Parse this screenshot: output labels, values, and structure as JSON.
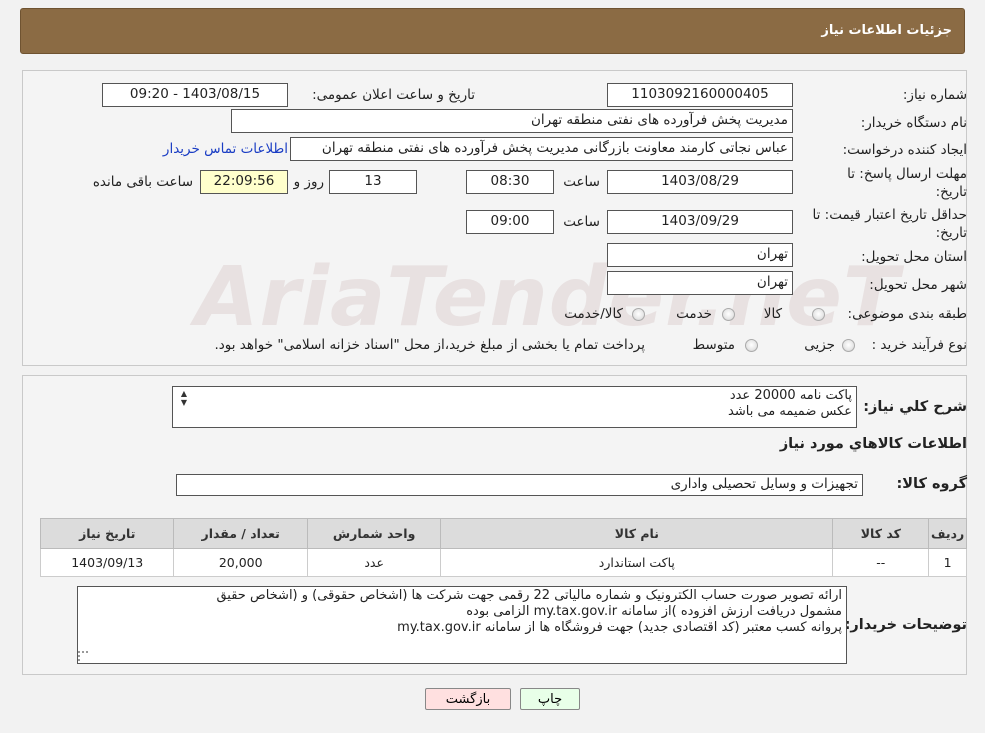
{
  "header": {
    "title": "جزئیات اطلاعات نیاز"
  },
  "form": {
    "need_number_label": "شماره نیاز:",
    "need_number": "1103092160000405",
    "announce_label": "تاریخ و ساعت اعلان عمومی:",
    "announce_value": "1403/08/15 - 09:20",
    "buyer_org_label": "نام دستگاه خریدار:",
    "buyer_org": "مدیریت پخش فرآورده های نفتی منطقه تهران",
    "creator_label": "ایجاد کننده درخواست:",
    "creator": "عباس نجاتی کارمند معاونت بازرگانی مدیریت پخش فرآورده های نفتی منطقه تهران",
    "contact_link": "اطلاعات تماس خریدار",
    "deadline_label_1": "مهلت ارسال پاسخ: تا",
    "deadline_label_2": "تاریخ:",
    "deadline_date": "1403/08/29",
    "time_label": "ساعت",
    "deadline_time": "08:30",
    "days": "13",
    "days_label": "روز و",
    "remaining": "22:09:56",
    "remaining_label": "ساعت باقی مانده",
    "validity_label_1": "حداقل تاریخ اعتبار قیمت: تا",
    "validity_label_2": "تاریخ:",
    "validity_date": "1403/09/29",
    "validity_time": "09:00",
    "province_label": "استان محل تحویل:",
    "province": "تهران",
    "city_label": "شهر محل تحویل:",
    "city": "تهران",
    "category_label": "طبقه بندی موضوعی:",
    "category_options": [
      "کالا",
      "خدمت",
      "کالا/خدمت"
    ],
    "process_label": "نوع فرآیند خرید :",
    "process_options": [
      "جزیی",
      "متوسط"
    ],
    "process_note": "پرداخت تمام یا بخشی از مبلغ خرید،از محل \"اسناد خزانه اسلامی\" خواهد بود."
  },
  "description": {
    "label": "شرح کلي نیاز:",
    "lines": [
      "پاکت نامه 20000 عدد",
      "عکس ضمیمه می باشد"
    ]
  },
  "goods": {
    "section_title": "اطلاعات کالاهاي مورد نیاز",
    "group_label": "گروه کالا:",
    "group_value": "تجهیزات و وسایل تحصیلی واداری"
  },
  "table": {
    "headers": [
      "ردیف",
      "کد کالا",
      "نام کالا",
      "واحد شمارش",
      "تعداد / مقدار",
      "تاریخ نیاز"
    ],
    "rows": [
      {
        "row": "1",
        "code": "--",
        "name": "پاکت استاندارد",
        "unit": "عدد",
        "qty": "20,000",
        "date": "1403/09/13"
      }
    ]
  },
  "buyer_notes": {
    "label": "توضیحات خریدار:",
    "lines": [
      "ارائه  تصویر صورت حساب الکترونیک و شماره مالیاتی 22 رقمی  جهت شرکت ها (اشخاص حقوقی) و (اشخاص حقیق",
      "مشمول دریافت ارزش افزوده )از سامانه my.tax.gov.ir  الزامی بوده",
      "پروانه کسب معتبر (کد اقتصادی جدید) جهت فروشگاه ها از سامانه my.tax.gov.ir"
    ]
  },
  "buttons": {
    "print": "چاپ",
    "back": "بازگشت"
  },
  "watermark": "AriaTender.neT",
  "colors": {
    "header_bg": "#8b6b44",
    "link": "#1a3dc4",
    "back_button_bg": "#ffe0e0",
    "print_button_bg": "#e8ffe8",
    "timer_bg": "#ffffcc"
  }
}
